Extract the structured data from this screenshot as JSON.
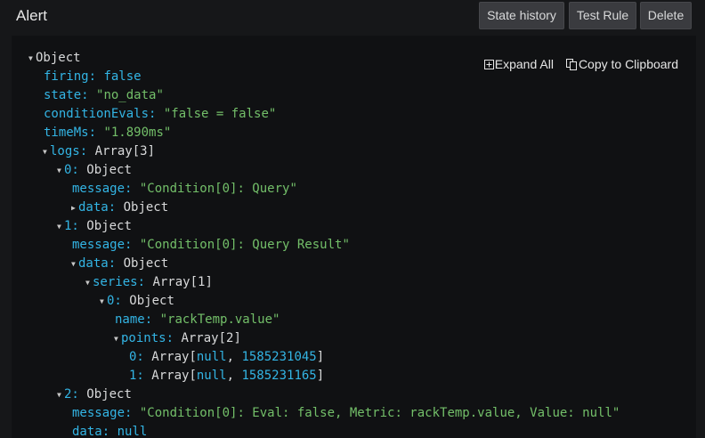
{
  "header": {
    "title": "Alert",
    "state_history_label": "State history",
    "test_rule_label": "Test Rule",
    "delete_label": "Delete"
  },
  "toolbar": {
    "expand_all_label": "Expand All",
    "copy_label": "Copy to Clipboard"
  },
  "tree": {
    "root": "Object",
    "firing_key": "firing:",
    "firing_val": "false",
    "state_key": "state:",
    "state_val": "\"no_data\"",
    "cond_key": "conditionEvals:",
    "cond_val": "\"false = false\"",
    "time_key": "timeMs:",
    "time_val": "\"1.890ms\"",
    "logs_key": "logs:",
    "logs_type": "Array[3]",
    "log0_key": "0:",
    "log0_type": "Object",
    "log0_msg_key": "message:",
    "log0_msg_val": "\"Condition[0]: Query\"",
    "log0_data_key": "data:",
    "log0_data_type": "Object",
    "log1_key": "1:",
    "log1_type": "Object",
    "log1_msg_key": "message:",
    "log1_msg_val": "\"Condition[0]: Query Result\"",
    "log1_data_key": "data:",
    "log1_data_type": "Object",
    "series_key": "series:",
    "series_type": "Array[1]",
    "series0_key": "0:",
    "series0_type": "Object",
    "name_key": "name:",
    "name_val": "\"rackTemp.value\"",
    "points_key": "points:",
    "points_type": "Array[2]",
    "p0_key": "0:",
    "p0_open": "Array[",
    "p0_a": "null",
    "p0_sep": ", ",
    "p0_b": "1585231045",
    "p0_close": "]",
    "p1_key": "1:",
    "p1_open": "Array[",
    "p1_a": "null",
    "p1_sep": ", ",
    "p1_b": "1585231165",
    "p1_close": "]",
    "log2_key": "2:",
    "log2_type": "Object",
    "log2_msg_key": "message:",
    "log2_msg_val": "\"Condition[0]: Eval: false, Metric: rackTemp.value, Value: null\"",
    "log2_data_key": "data:",
    "log2_data_val": "null"
  }
}
